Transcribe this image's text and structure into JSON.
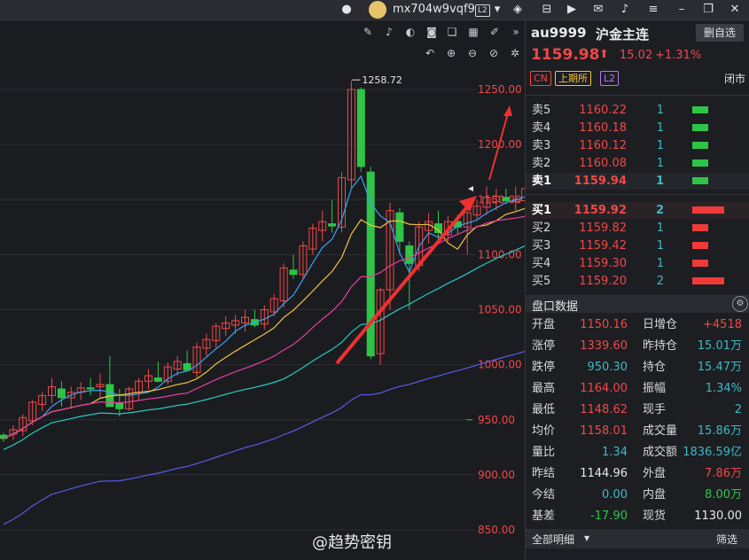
{
  "topbar": {
    "username": "mx704w9vqf9",
    "level_badge": "L2",
    "icons": [
      "robot-icon",
      "user-avatar",
      "layers-icon",
      "pin-icon",
      "media-icon",
      "mail-icon",
      "bell-icon",
      "menu-icon",
      "restore-icon",
      "close-icon"
    ]
  },
  "chart": {
    "toolbar_top": [
      "pencil-icon",
      "bell-icon",
      "toggle-icon",
      "camera-icon",
      "copy-icon",
      "grid-icon",
      "pen-off-icon",
      "collapse-icon"
    ],
    "toolbar_second": [
      "undo-icon",
      "zoom-in-icon",
      "zoom-out-icon",
      "eye-off-icon",
      "settings-icon"
    ],
    "high_marker": "1258.72",
    "price_labels": [
      "1250.00",
      "1200.00",
      "1150.00",
      "1100.00",
      "1050.00",
      "1000.00",
      "950.00",
      "900.00",
      "850.00"
    ],
    "colors": {
      "up": "#f04848",
      "down": "#2ec447",
      "ma5": "#f5f5f5",
      "ma10": "#3aa0f0",
      "ma20": "#f5c33b",
      "ma40": "#e83ea0",
      "ma60": "#26c9c0",
      "ma120": "#5a5ae6",
      "annotation": "#f03030"
    }
  },
  "chart_data": {
    "type": "candlestick",
    "ylim": [
      840,
      1270
    ],
    "gridlines": [
      1250,
      1200,
      1150,
      1100,
      1050,
      1000,
      950,
      900,
      850
    ],
    "candles": [
      [
        936,
        938,
        930,
        933
      ],
      [
        937,
        945,
        932,
        941
      ],
      [
        940,
        955,
        935,
        952
      ],
      [
        949,
        968,
        945,
        966
      ],
      [
        964,
        975,
        958,
        972
      ],
      [
        972,
        988,
        965,
        980
      ],
      [
        978,
        985,
        962,
        970
      ],
      [
        970,
        980,
        960,
        975
      ],
      [
        975,
        984,
        968,
        979
      ],
      [
        979,
        988,
        972,
        978
      ],
      [
        980,
        992,
        970,
        982
      ],
      [
        982,
        1008,
        962,
        962
      ],
      [
        965,
        978,
        953,
        960
      ],
      [
        960,
        980,
        958,
        978
      ],
      [
        975,
        988,
        968,
        985
      ],
      [
        985,
        996,
        978,
        990
      ],
      [
        988,
        1003,
        984,
        985
      ],
      [
        985,
        1002,
        982,
        998
      ],
      [
        996,
        1008,
        990,
        1003
      ],
      [
        1001,
        1013,
        994,
        995
      ],
      [
        993,
        1020,
        988,
        1016
      ],
      [
        1015,
        1028,
        1008,
        1023
      ],
      [
        1022,
        1038,
        1015,
        1035
      ],
      [
        1033,
        1044,
        1026,
        1038
      ],
      [
        1036,
        1045,
        1028,
        1040
      ],
      [
        1038,
        1050,
        1030,
        1043
      ],
      [
        1041,
        1050,
        1034,
        1036
      ],
      [
        1037,
        1054,
        1032,
        1050
      ],
      [
        1048,
        1064,
        1044,
        1060
      ],
      [
        1058,
        1092,
        1052,
        1088
      ],
      [
        1086,
        1100,
        1078,
        1082
      ],
      [
        1082,
        1112,
        1078,
        1108
      ],
      [
        1105,
        1128,
        1100,
        1124
      ],
      [
        1122,
        1140,
        1112,
        1130
      ],
      [
        1128,
        1150,
        1120,
        1126
      ],
      [
        1125,
        1175,
        1120,
        1170
      ],
      [
        1168,
        1258,
        1160,
        1250
      ],
      [
        1250,
        1252,
        1175,
        1180
      ],
      [
        1175,
        1180,
        1005,
        1008
      ],
      [
        1010,
        1070,
        1000,
        1068
      ],
      [
        1068,
        1147,
        1050,
        1140
      ],
      [
        1138,
        1142,
        1100,
        1112
      ],
      [
        1108,
        1112,
        1050,
        1092
      ],
      [
        1090,
        1130,
        1085,
        1125
      ],
      [
        1122,
        1138,
        1110,
        1130
      ],
      [
        1128,
        1140,
        1114,
        1120
      ],
      [
        1118,
        1135,
        1112,
        1130
      ],
      [
        1130,
        1136,
        1118,
        1125
      ],
      [
        1125,
        1140,
        1100,
        1138
      ],
      [
        1136,
        1150,
        1132,
        1144
      ],
      [
        1143,
        1162,
        1136,
        1152
      ],
      [
        1148,
        1160,
        1140,
        1153
      ],
      [
        1152,
        1160,
        1146,
        1149
      ],
      [
        1148,
        1162,
        1140,
        1150
      ],
      [
        1149,
        1164,
        1148,
        1159.98
      ]
    ],
    "ma": {
      "ma10": [
        935,
        940,
        947,
        955,
        962,
        968,
        973,
        975,
        977,
        980,
        982,
        980,
        977,
        977,
        978,
        980,
        982,
        985,
        988,
        990,
        995,
        1000,
        1008,
        1015,
        1022,
        1028,
        1032,
        1036,
        1040,
        1048,
        1058,
        1066,
        1075,
        1085,
        1093,
        1102,
        1118,
        1132,
        1128,
        1122,
        1118,
        1112,
        1108,
        1106,
        1110,
        1115,
        1118,
        1122,
        1125,
        1128,
        1132,
        1135,
        1138,
        1142,
        1145
      ],
      "ma20": [
        920,
        924,
        928,
        933,
        938,
        944,
        949,
        954,
        958,
        962,
        966,
        969,
        971,
        973,
        975,
        977,
        979,
        982,
        985,
        987,
        990,
        993,
        996,
        1000,
        1004,
        1009,
        1015,
        1021,
        1028,
        1034,
        1041,
        1048,
        1055,
        1062,
        1069,
        1077,
        1086,
        1095,
        1099,
        1102,
        1106,
        1108,
        1110,
        1111,
        1113,
        1115,
        1117,
        1119,
        1121,
        1124,
        1127,
        1130,
        1133,
        1136,
        1140
      ]
    },
    "volume_labels": []
  },
  "panel": {
    "symbol": "au9999",
    "symbol_name": "沪金主连",
    "switch_label": "删自选",
    "last_price": "1159.98",
    "change": "15.02",
    "change_pct": "+1.31%",
    "tags": [
      "CN",
      "上期所",
      "L2"
    ],
    "status": "闭市",
    "asks": [
      {
        "label": "卖5",
        "price": "1160.22",
        "vol": "1"
      },
      {
        "label": "卖4",
        "price": "1160.18",
        "vol": "1"
      },
      {
        "label": "卖3",
        "price": "1160.12",
        "vol": "1"
      },
      {
        "label": "卖2",
        "price": "1160.08",
        "vol": "1"
      },
      {
        "label": "卖1",
        "price": "1159.94",
        "vol": "1"
      }
    ],
    "bids": [
      {
        "label": "买1",
        "price": "1159.92",
        "vol": "2"
      },
      {
        "label": "买2",
        "price": "1159.82",
        "vol": "1"
      },
      {
        "label": "买3",
        "price": "1159.42",
        "vol": "1"
      },
      {
        "label": "买4",
        "price": "1159.30",
        "vol": "1"
      },
      {
        "label": "买5",
        "price": "1159.20",
        "vol": "2"
      }
    ],
    "depth_title": "盘口数据",
    "stats_left": [
      {
        "k": "开盘",
        "v": "1150.16",
        "c": "#f04848"
      },
      {
        "k": "涨停",
        "v": "1339.60",
        "c": "#f04848"
      },
      {
        "k": "跌停",
        "v": "950.30",
        "c": "#3fb8c6"
      },
      {
        "k": "最高",
        "v": "1164.00",
        "c": "#f04848"
      },
      {
        "k": "最低",
        "v": "1148.62",
        "c": "#f04848"
      },
      {
        "k": "均价",
        "v": "1158.01",
        "c": "#f04848"
      },
      {
        "k": "量比",
        "v": "1.34",
        "c": "#3fb8c6"
      },
      {
        "k": "昨结",
        "v": "1144.96",
        "c": "#e6e6e6"
      },
      {
        "k": "今结",
        "v": "0.00",
        "c": "#3fb8c6"
      },
      {
        "k": "基差",
        "v": "-17.90",
        "c": "#2ec447"
      }
    ],
    "stats_right": [
      {
        "k": "日增仓",
        "v": "+4518",
        "c": "#f04848"
      },
      {
        "k": "昨持仓",
        "v": "15.01万",
        "c": "#3fb8c6"
      },
      {
        "k": "持仓",
        "v": "15.47万",
        "c": "#3fb8c6"
      },
      {
        "k": "振幅",
        "v": "1.34%",
        "c": "#3fb8c6"
      },
      {
        "k": "现手",
        "v": "2",
        "c": "#3fb8c6"
      },
      {
        "k": "成交量",
        "v": "15.86万",
        "c": "#3fb8c6"
      },
      {
        "k": "成交额",
        "v": "1836.59亿",
        "c": "#3fb8c6"
      },
      {
        "k": "外盘",
        "v": "7.86万",
        "c": "#f04848"
      },
      {
        "k": "内盘",
        "v": "8.00万",
        "c": "#2ec447"
      },
      {
        "k": "现货",
        "v": "1130.00",
        "c": "#e6e6e6"
      }
    ],
    "all_detail": "全部明细",
    "filter": "筛选"
  },
  "watermark": "@趋势密钥"
}
